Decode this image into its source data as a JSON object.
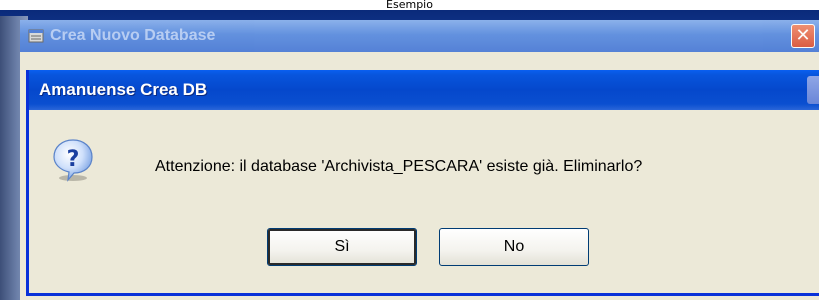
{
  "top_caption": "Esempio",
  "background_window": {
    "title": "Crea Nuovo Database",
    "close_symbol": "✕"
  },
  "dialog": {
    "title": "Amanuense Crea DB",
    "icon": "question-icon",
    "message": "Attenzione: il database 'Archivista_PESCARA' esiste già. Eliminarlo?",
    "buttons": {
      "yes": "Sì",
      "no": "No"
    }
  },
  "colors": {
    "titlebar_blue": "#0548cc",
    "dialog_face": "#ece9d8",
    "close_red": "#d8452a"
  }
}
